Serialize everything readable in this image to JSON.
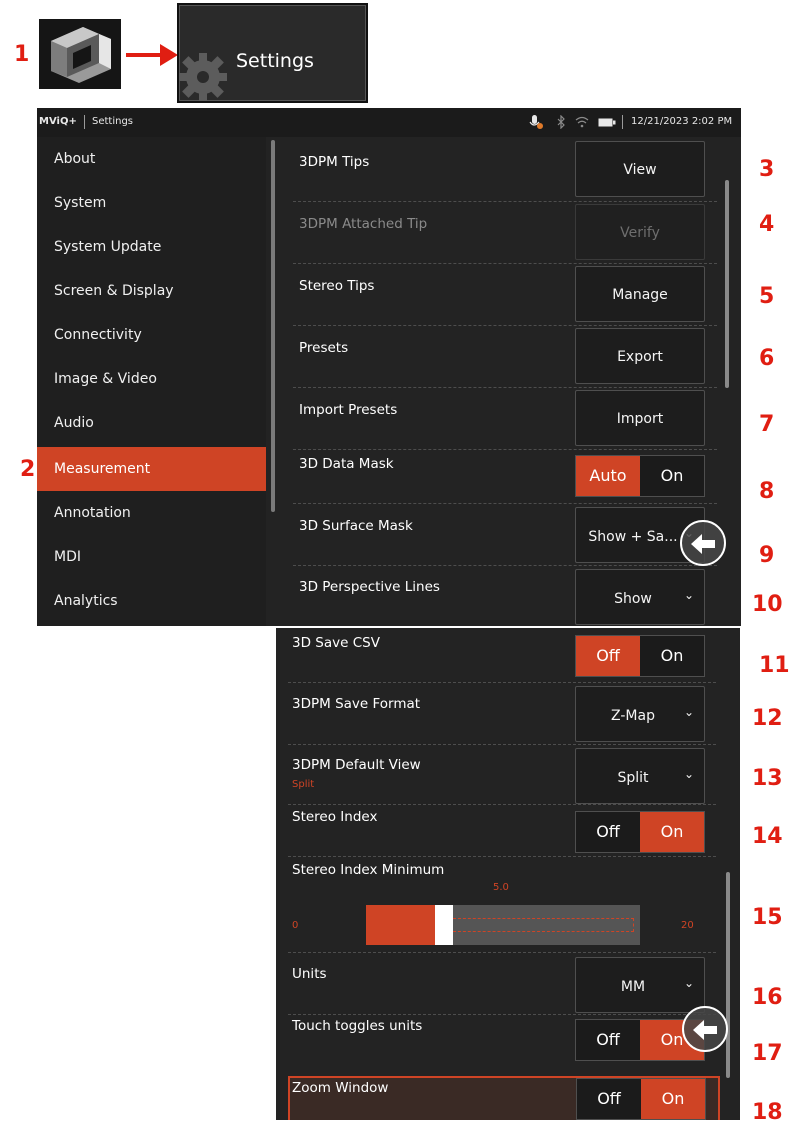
{
  "top": {
    "settings_tile_label": "Settings",
    "app_icon": "app-cube-icon",
    "gear_icon": "gear-icon",
    "arrow_icon": "arrow-right-icon"
  },
  "callouts": [
    "1",
    "2",
    "3",
    "4",
    "5",
    "6",
    "7",
    "8",
    "9",
    "10",
    "11",
    "12",
    "13",
    "14",
    "15",
    "16",
    "17",
    "18"
  ],
  "statusbar": {
    "app_name": "MViQ+",
    "section": "Settings",
    "datetime": "12/21/2023  2:02 PM",
    "icons": [
      "mic-icon",
      "bluetooth-icon",
      "wifi-icon",
      "battery-icon"
    ]
  },
  "sidebar": {
    "items": [
      {
        "label": "About"
      },
      {
        "label": "System"
      },
      {
        "label": "System Update"
      },
      {
        "label": "Screen & Display"
      },
      {
        "label": "Connectivity"
      },
      {
        "label": "Image & Video"
      },
      {
        "label": "Audio"
      },
      {
        "label": "Measurement",
        "selected": true
      },
      {
        "label": "Annotation"
      },
      {
        "label": "MDI"
      },
      {
        "label": "Analytics"
      }
    ]
  },
  "settings_top": [
    {
      "label": "3DPM Tips",
      "control": "button",
      "value": "View"
    },
    {
      "label": "3DPM Attached Tip",
      "control": "button",
      "value": "Verify",
      "disabled": true
    },
    {
      "label": "Stereo Tips",
      "control": "button",
      "value": "Manage"
    },
    {
      "label": "Presets",
      "control": "button",
      "value": "Export"
    },
    {
      "label": "Import Presets",
      "control": "button",
      "value": "Import"
    },
    {
      "label": "3D Data Mask",
      "control": "toggle",
      "left": "Auto",
      "right": "On",
      "active": "left"
    },
    {
      "label": "3D Surface Mask",
      "control": "dropdown",
      "value": "Show + Sa..."
    },
    {
      "label": "3D Perspective Lines",
      "control": "dropdown",
      "value": "Show"
    }
  ],
  "settings_bottom": [
    {
      "label": "3D Save CSV",
      "control": "toggle",
      "left": "Off",
      "right": "On",
      "active": "left"
    },
    {
      "label": "3DPM Save Format",
      "control": "dropdown",
      "value": "Z-Map"
    },
    {
      "label": "3DPM Default View",
      "sublabel": "Split",
      "control": "dropdown",
      "value": "Split"
    },
    {
      "label": "Stereo Index",
      "control": "toggle",
      "left": "Off",
      "right": "On",
      "active": "right"
    },
    {
      "label": "Stereo Index Minimum",
      "control": "slider",
      "min": "0",
      "max": "20",
      "value": "5.0",
      "value_num": 5.0,
      "range": [
        0,
        20
      ]
    },
    {
      "label": "Units",
      "control": "dropdown",
      "value": "MM"
    },
    {
      "label": "Touch toggles units",
      "control": "toggle",
      "left": "Off",
      "right": "On",
      "active": "right"
    },
    {
      "label": "Zoom Window",
      "control": "toggle",
      "left": "Off",
      "right": "On",
      "active": "right",
      "highlighted": true
    }
  ],
  "colors": {
    "accent": "#cf4425",
    "callout": "#e01e12",
    "panel": "#232323",
    "sidebar": "#1f1f1f"
  }
}
